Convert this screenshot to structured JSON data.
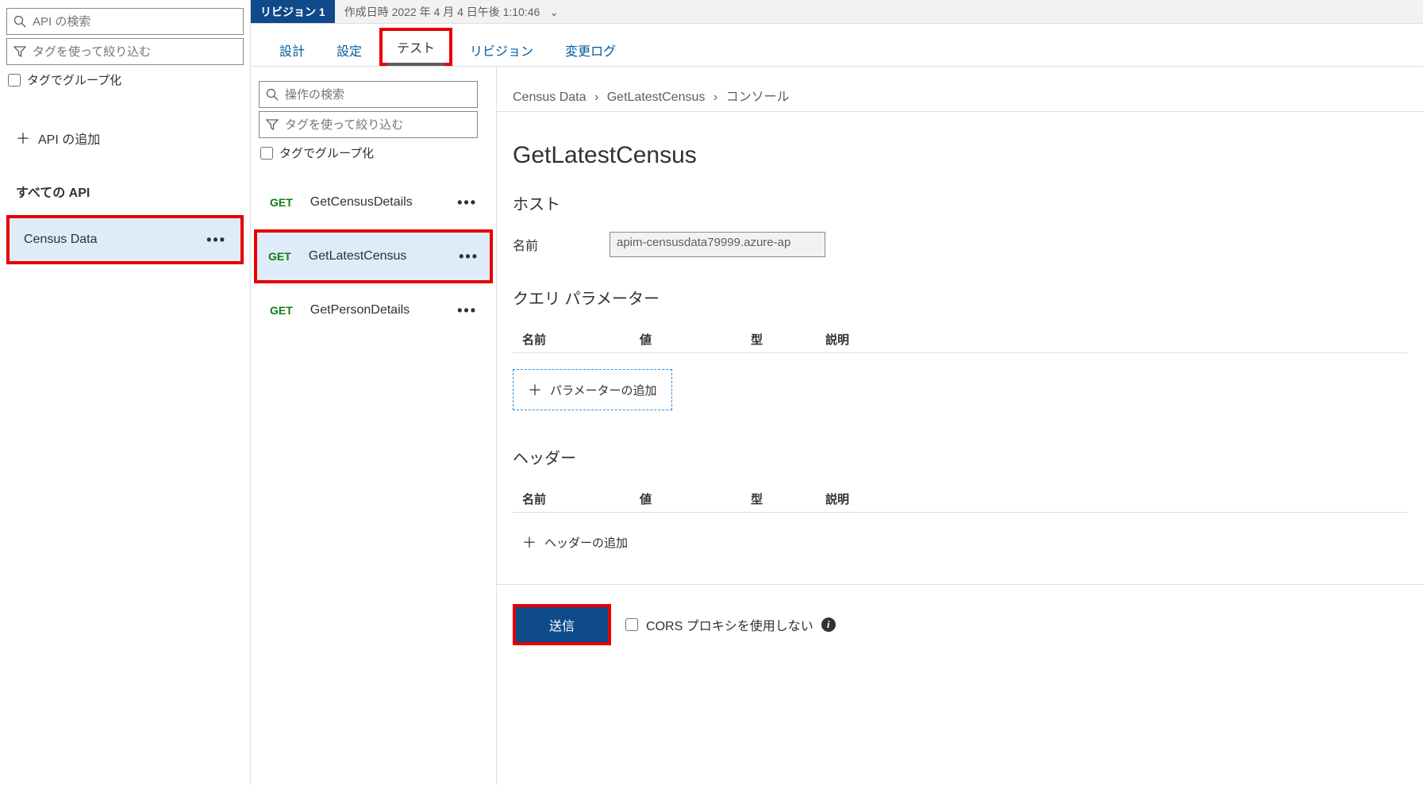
{
  "sidebar": {
    "search_placeholder": "API の検索",
    "filter_placeholder": "タグを使って絞り込む",
    "group_by_tag": "タグでグループ化",
    "add_api": "API の追加",
    "all_apis": "すべての API",
    "apis": [
      {
        "name": "Census Data",
        "selected": true
      }
    ]
  },
  "topbar": {
    "revision_badge": "リビジョン 1",
    "revision_date": "作成日時 2022 年 4 月 4 日午後 1:10:46"
  },
  "tabs": [
    {
      "label": "設計",
      "active": false
    },
    {
      "label": "設定",
      "active": false
    },
    {
      "label": "テスト",
      "active": true
    },
    {
      "label": "リビジョン",
      "active": false
    },
    {
      "label": "変更ログ",
      "active": false
    }
  ],
  "ops_panel": {
    "search_placeholder": "操作の検索",
    "filter_placeholder": "タグを使って絞り込む",
    "group_by_tag": "タグでグループ化",
    "operations": [
      {
        "method": "GET",
        "name": "GetCensusDetails",
        "selected": false
      },
      {
        "method": "GET",
        "name": "GetLatestCensus",
        "selected": true
      },
      {
        "method": "GET",
        "name": "GetPersonDetails",
        "selected": false
      }
    ]
  },
  "detail": {
    "breadcrumb": [
      "Census Data",
      "GetLatestCensus",
      "コンソール"
    ],
    "title": "GetLatestCensus",
    "host_section": "ホスト",
    "host_label": "名前",
    "host_value": "apim-censusdata79999.azure-ap",
    "query_section": "クエリ パラメーター",
    "columns": {
      "name": "名前",
      "value": "値",
      "type": "型",
      "desc": "説明"
    },
    "add_param": "パラメーターの追加",
    "header_section": "ヘッダー",
    "add_header": "ヘッダーの追加",
    "send": "送信",
    "cors_label": "CORS プロキシを使用しない"
  }
}
